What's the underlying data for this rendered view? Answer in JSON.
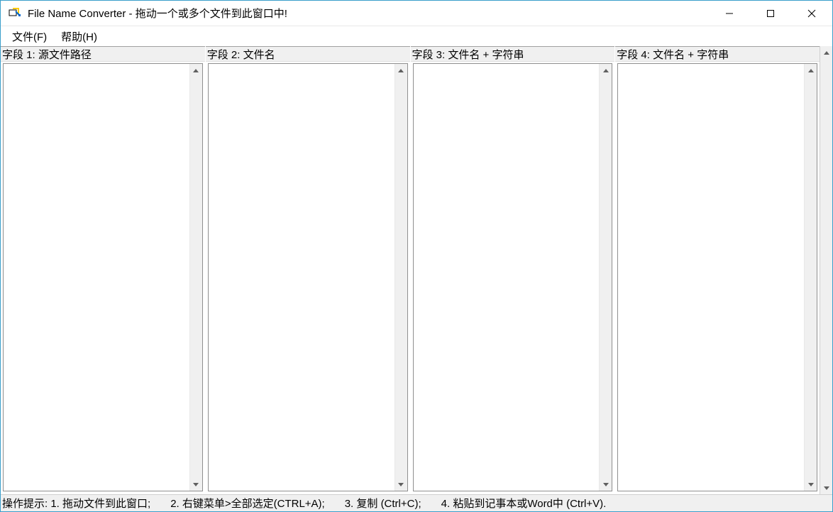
{
  "titlebar": {
    "title": "File Name Converter - 拖动一个或多个文件到此窗口中!"
  },
  "menubar": {
    "items": [
      {
        "label": "文件(F)"
      },
      {
        "label": "帮助(H)"
      }
    ]
  },
  "columns": [
    {
      "header": "字段 1: 源文件路径",
      "value": ""
    },
    {
      "header": "字段 2: 文件名",
      "value": ""
    },
    {
      "header": "字段 3: 文件名  + 字符串",
      "value": ""
    },
    {
      "header": "字段 4: 文件名 + 字符串",
      "value": ""
    }
  ],
  "statusbar": {
    "segments": [
      "操作提示: 1. 拖动文件到此窗口;",
      "2. 右键菜单>全部选定(CTRL+A);",
      "3. 复制 (Ctrl+C);",
      "4. 粘贴到记事本或Word中 (Ctrl+V)."
    ]
  }
}
